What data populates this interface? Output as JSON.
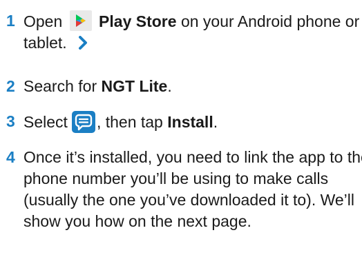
{
  "steps": [
    {
      "number": "1",
      "open_word": "Open",
      "store_name": "Play Store",
      "rest": "on your Android phone or tablet.",
      "store_icon": "play-store-icon",
      "arrow_icon": "chevron-right-icon"
    },
    {
      "number": "2",
      "prefix": "Search for",
      "app_name": "NGT Lite",
      "suffix": "."
    },
    {
      "number": "3",
      "prefix": "Select",
      "app_icon": "ngt-lite-app-icon",
      "middle": ", then tap",
      "action": "Install",
      "suffix": "."
    },
    {
      "number": "4",
      "text": "Once it’s installed, you need to link the app to the phone number you’ll be using to make calls (usually the one you’ve downloaded it to). We’ll show you how on the next page."
    }
  ],
  "colors": {
    "accent": "#1b7fc4",
    "text": "#1a1a1a",
    "tile_bg": "#e9e9e9"
  }
}
